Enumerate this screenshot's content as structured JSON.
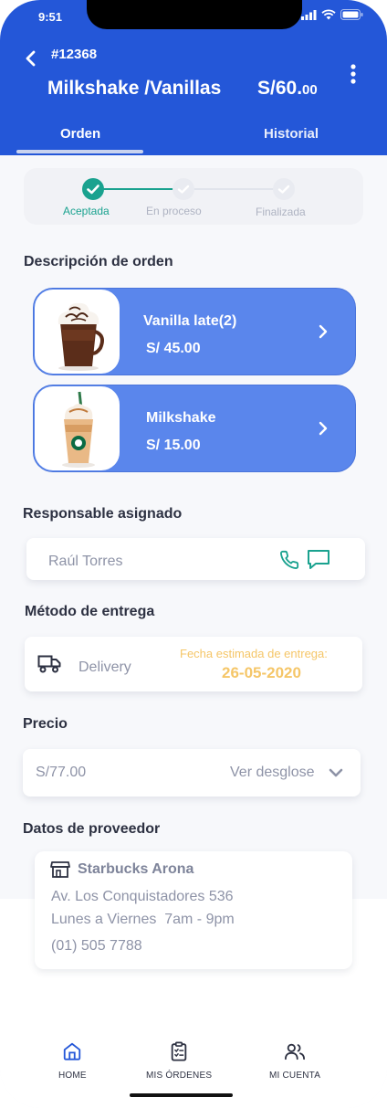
{
  "status": {
    "time": "9:51"
  },
  "header": {
    "order_id": "#12368",
    "title": "Milkshake /Vanillas",
    "price_main": "S/60.",
    "price_cents": "00",
    "tabs": [
      {
        "label": "Orden",
        "active": true
      },
      {
        "label": "Historial",
        "active": false
      }
    ]
  },
  "stepper": {
    "steps": [
      {
        "label": "Aceptada",
        "state": "done"
      },
      {
        "label": "En proceso",
        "state": "pending"
      },
      {
        "label": "Finalizada",
        "state": "pending"
      }
    ]
  },
  "order_description": {
    "title": "Descripción de orden",
    "items": [
      {
        "name": "Vanilla late(2)",
        "price": "S/ 45.00",
        "image": "hot-chocolate-cup"
      },
      {
        "name": "Milkshake",
        "price": "S/ 15.00",
        "image": "starbucks-frappe-cup"
      }
    ]
  },
  "assignee": {
    "title": "Responsable asignado",
    "name": "Raúl Torres"
  },
  "delivery": {
    "title": "Método de entrega",
    "method": "Delivery",
    "eta_label": "Fecha estimada de entrega:",
    "eta_date": "26-05-2020"
  },
  "pricing": {
    "title": "Precio",
    "value": "S/77.00",
    "breakdown_label": "Ver desglose"
  },
  "provider": {
    "title": "Datos de proveedor",
    "name": "Starbucks Arona",
    "address": "Av. Los Conquistadores 536",
    "hours": "Lunes a Viernes  7am - 9pm",
    "phone": "(01) 505 7788"
  },
  "nav": {
    "items": [
      {
        "label": "HOME",
        "icon": "home-icon"
      },
      {
        "label": "MIS ÓRDENES",
        "icon": "clipboard-icon"
      },
      {
        "label": "MI CUENTA",
        "icon": "users-icon"
      }
    ]
  },
  "colors": {
    "primary": "#2457d8",
    "card_blue": "#5a86ec",
    "success": "#1aa28f",
    "accent_orange": "#f5c668"
  }
}
